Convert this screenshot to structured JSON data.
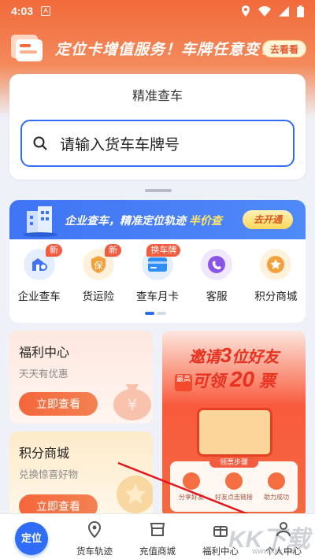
{
  "status_bar": {
    "time": "4:03",
    "notif_icon": "A"
  },
  "promo_banner": {
    "text": "定位卡增值服务！车牌任意变！",
    "button": "去看看"
  },
  "search": {
    "title": "精准查车",
    "placeholder": "请输入货车车牌号"
  },
  "enterprise": {
    "banner_text_a": "企业查车，精准定位轨迹",
    "banner_text_b": "半价查",
    "banner_button": "去开通",
    "items": [
      {
        "label": "企业查车",
        "badge": "新",
        "icon": "enterprise-search-icon",
        "color": "#3f74f4"
      },
      {
        "label": "货运险",
        "badge": "新",
        "icon": "insurance-icon",
        "badge_text_icon": "保",
        "color": "#f3a23b"
      },
      {
        "label": "查车月卡",
        "badge": "换车牌",
        "icon": "card-icon",
        "color": "#2f8ef6"
      },
      {
        "label": "客服",
        "badge": "",
        "icon": "customer-service-icon",
        "color": "#8a55e6"
      },
      {
        "label": "积分商城",
        "badge": "",
        "icon": "points-mall-icon",
        "color": "#f3a23b"
      }
    ]
  },
  "welfare_card": {
    "title": "福利中心",
    "subtitle": "天天有优惠",
    "button": "立即查看"
  },
  "points_card": {
    "title": "积分商城",
    "subtitle": "兑换惊喜好物",
    "button": "立即查看"
  },
  "invite_ad": {
    "line1_a": "邀请",
    "line1_num": "3",
    "line1_b": "位好友",
    "tag": "最高",
    "line2_a": "可领",
    "line2_num": "20",
    "line2_b": "票",
    "steps_title": "领票步骤",
    "steps": [
      "分享好友",
      "好友点击链接",
      "助力成功"
    ]
  },
  "bottom_nav": {
    "locate": "定位",
    "items": [
      {
        "label": "货车轨迹",
        "icon": "location-pin-icon"
      },
      {
        "label": "充值商城",
        "icon": "shop-icon"
      },
      {
        "label": "福利中心",
        "icon": "gift-icon"
      },
      {
        "label": "个人中心",
        "icon": "person-icon"
      }
    ]
  },
  "watermark": {
    "text": "KK下载",
    "url": "www.kkx.net"
  }
}
